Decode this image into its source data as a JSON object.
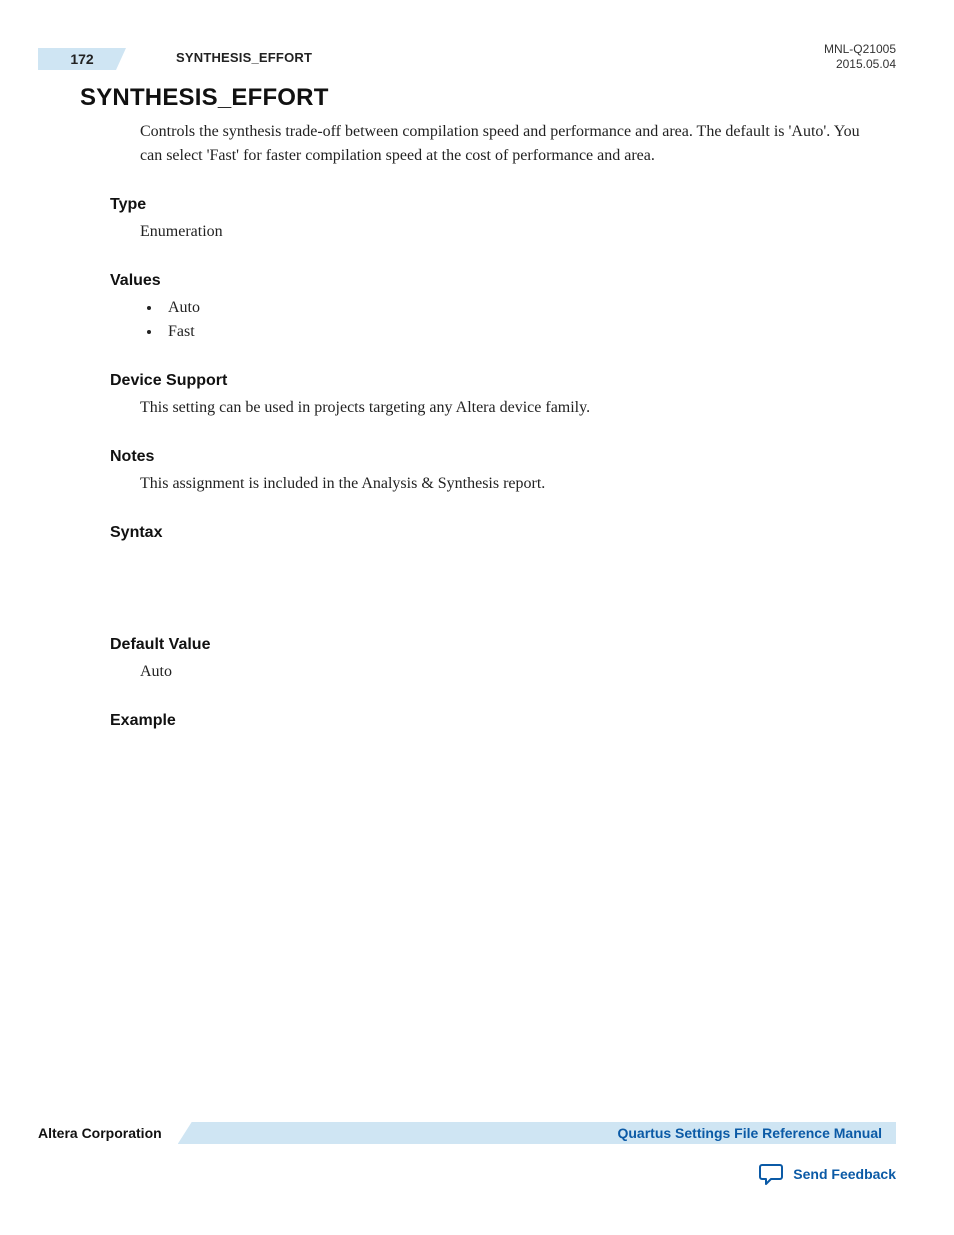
{
  "header": {
    "page_number": "172",
    "running_title": "SYNTHESIS_EFFORT",
    "doc_id": "MNL-Q21005",
    "date": "2015.05.04"
  },
  "title": "SYNTHESIS_EFFORT",
  "intro": "Controls the synthesis trade-off between compilation speed and performance and area. The default is 'Auto'. You can select 'Fast' for faster compilation speed at the cost of performance and area.",
  "sections": {
    "type": {
      "heading": "Type",
      "body": "Enumeration"
    },
    "values": {
      "heading": "Values",
      "items": [
        "Auto",
        "Fast"
      ]
    },
    "device_support": {
      "heading": "Device Support",
      "body": "This setting can be used in projects targeting any Altera device family."
    },
    "notes": {
      "heading": "Notes",
      "body": "This assignment is included in the Analysis & Synthesis report."
    },
    "syntax": {
      "heading": "Syntax"
    },
    "default_value": {
      "heading": "Default Value",
      "body": "Auto"
    },
    "example": {
      "heading": "Example"
    }
  },
  "footer": {
    "company": "Altera Corporation",
    "manual_link": "Quartus Settings File Reference Manual",
    "feedback_link": "Send Feedback"
  }
}
